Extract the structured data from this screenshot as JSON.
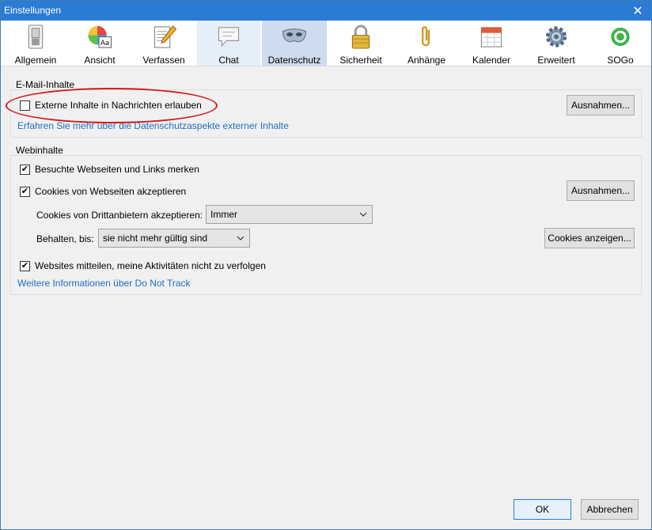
{
  "window": {
    "title": "Einstellungen"
  },
  "toolbar": {
    "tabs": [
      {
        "label": "Allgemein",
        "icon": "switch-icon"
      },
      {
        "label": "Ansicht",
        "icon": "palette-icon"
      },
      {
        "label": "Verfassen",
        "icon": "pencil-paper-icon"
      },
      {
        "label": "Chat",
        "icon": "speech-bubble-icon"
      },
      {
        "label": "Datenschutz",
        "icon": "mask-icon"
      },
      {
        "label": "Sicherheit",
        "icon": "padlock-icon"
      },
      {
        "label": "Anhänge",
        "icon": "paperclip-icon"
      },
      {
        "label": "Kalender",
        "icon": "calendar-icon"
      },
      {
        "label": "Erweitert",
        "icon": "gear-icon"
      },
      {
        "label": "SOGo",
        "icon": "sogo-icon"
      }
    ]
  },
  "email": {
    "legend": "E-Mail-Inhalte",
    "external_content": {
      "label": "Externe Inhalte in Nachrichten erlauben",
      "checked": false
    },
    "learn_more": "Erfahren Sie mehr über die Datenschutzaspekte externer Inhalte",
    "exceptions_button": "Ausnahmen..."
  },
  "web": {
    "legend": "Webinhalte",
    "remember_visited": {
      "label": "Besuchte Webseiten und Links merken",
      "checked": true
    },
    "accept_cookies": {
      "label": "Cookies von Webseiten akzeptieren",
      "checked": true
    },
    "exceptions_button": "Ausnahmen...",
    "third_party_label": "Cookies von Drittanbietern akzeptieren:",
    "third_party_value": "Immer",
    "keep_label": "Behalten, bis:",
    "keep_value": "sie nicht mehr gültig sind",
    "show_cookies_button": "Cookies anzeigen...",
    "do_not_track": {
      "label": "Websites mitteilen, meine Aktivitäten nicht zu verfolgen",
      "checked": true
    },
    "dnt_link": "Weitere Informationen über Do Not Track"
  },
  "footer": {
    "ok": "OK",
    "cancel": "Abbrechen"
  },
  "colors": {
    "titlebar": "#2b7bd4",
    "active_tab": "#cfdcef",
    "link": "#1f6fc5",
    "highlight_ellipse": "#d21a1a"
  }
}
